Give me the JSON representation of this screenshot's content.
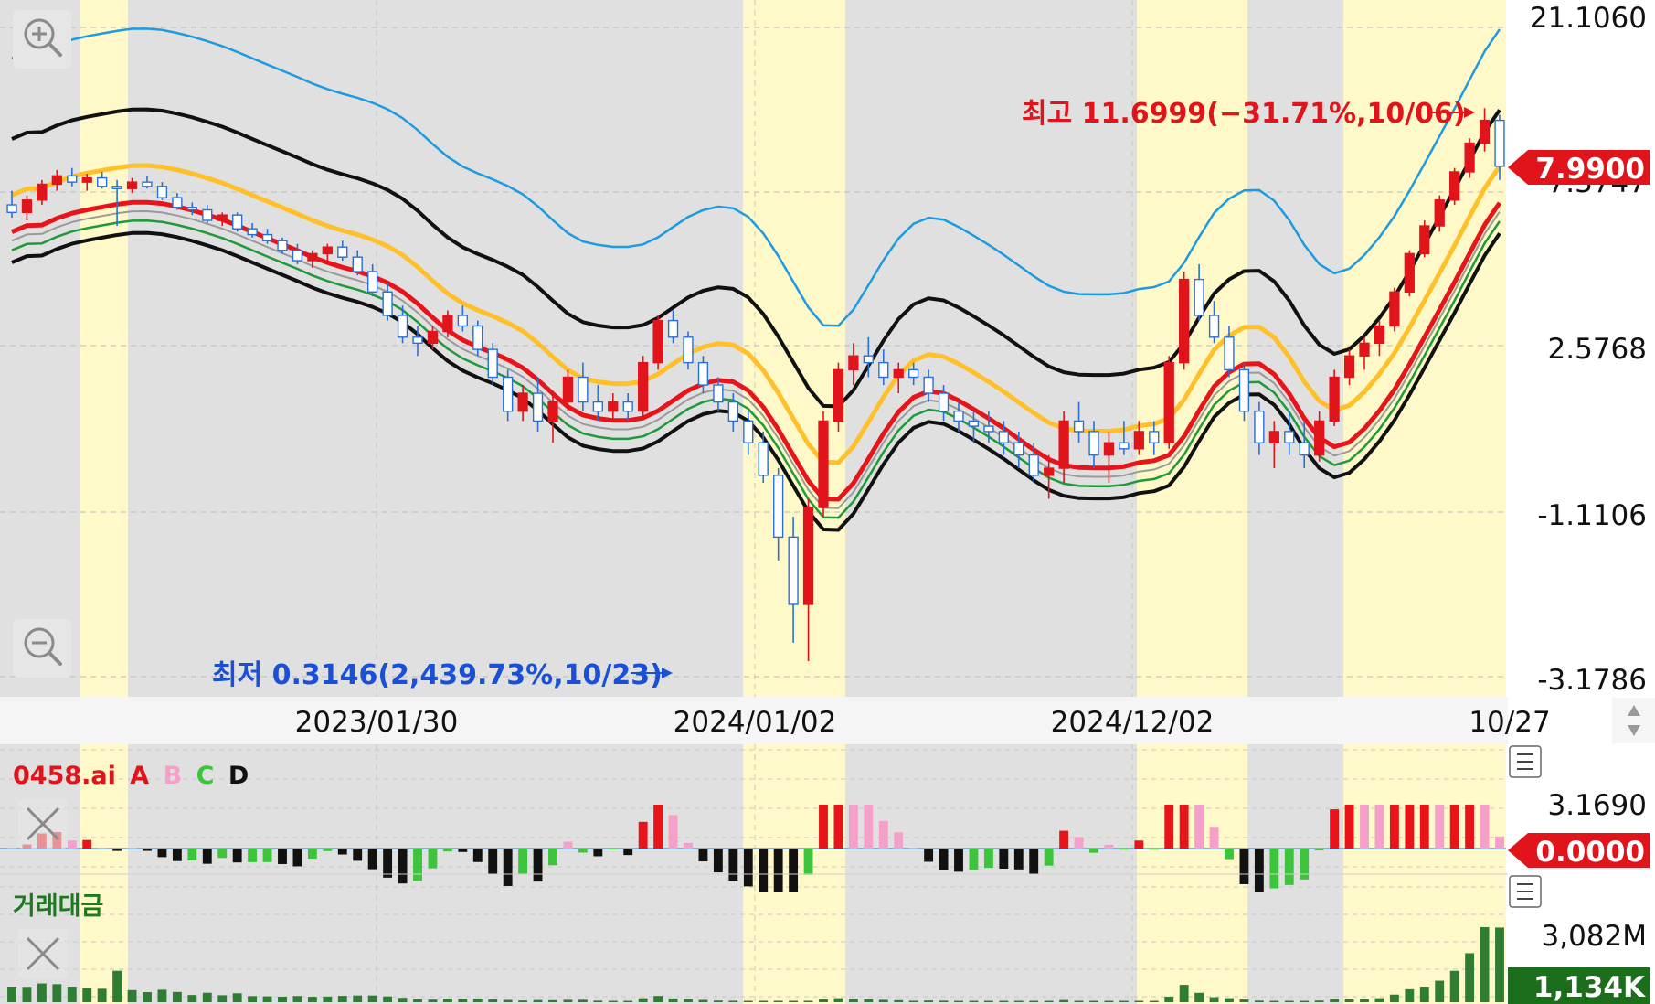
{
  "colors": {
    "up": "#e0141a",
    "down": "#2a6fd6",
    "shade_gray": "#e0e0e0",
    "shade_yellow": "#fff8c8",
    "ma_blue": "#1e9be0",
    "ma_black": "#111111",
    "ma_yellow": "#ffc02a",
    "ma_red": "#e8141a",
    "ma_gray": "#9a9a9a",
    "ma_green": "#1f9a3a",
    "vol_green": "#2e7d32",
    "osc_red": "#e8141a",
    "osc_pink": "#f4a0c8",
    "osc_green": "#3cc43c",
    "osc_black": "#111111"
  },
  "price_axis": {
    "ticks": [
      "21.1060",
      "2.5768",
      "-1.1106",
      "-3.1786"
    ],
    "hidden_tick": "7.3747",
    "current_badge": "7.9900"
  },
  "date_axis": {
    "labels": [
      "2023/01/30",
      "2024/01/02",
      "2024/12/02",
      "10/27"
    ]
  },
  "annotations": {
    "high": "최고 11.6999(−31.71%,10/06)",
    "low": "최저 0.3146(2,439.73%,10/23)"
  },
  "osc_pane": {
    "title_symbol": "0458.ai",
    "legend": [
      "A",
      "B",
      "C",
      "D"
    ],
    "max_label": "3.1690",
    "zero_badge": "0.0000"
  },
  "vol_pane": {
    "title": "거래대금",
    "max_label": "3,082M",
    "current_badge": "1,134K"
  },
  "icons": [
    "zoom-in-icon",
    "zoom-out-icon",
    "scroll-arrows-icon",
    "menu-icon",
    "close-icon"
  ],
  "chart_data": {
    "type": "candlestick",
    "y_scale": "log",
    "candles_ohlc_open_high_low_close": [
      [
        6.2,
        6.8,
        5.7,
        5.9
      ],
      [
        5.9,
        6.6,
        5.6,
        6.4
      ],
      [
        6.4,
        7.3,
        6.2,
        7.1
      ],
      [
        7.1,
        7.8,
        6.8,
        7.5
      ],
      [
        7.5,
        7.9,
        7.0,
        7.2
      ],
      [
        7.2,
        7.6,
        6.8,
        7.4
      ],
      [
        7.4,
        7.7,
        6.9,
        7.0
      ],
      [
        7.0,
        7.3,
        5.4,
        6.9
      ],
      [
        6.9,
        7.4,
        6.7,
        7.2
      ],
      [
        7.2,
        7.5,
        6.9,
        7.0
      ],
      [
        7.0,
        7.2,
        6.4,
        6.5
      ],
      [
        6.5,
        6.7,
        6.0,
        6.1
      ],
      [
        6.1,
        6.3,
        5.8,
        6.0
      ],
      [
        6.0,
        6.2,
        5.5,
        5.6
      ],
      [
        5.6,
        5.9,
        5.4,
        5.8
      ],
      [
        5.8,
        5.9,
        5.2,
        5.3
      ],
      [
        5.3,
        5.5,
        5.0,
        5.1
      ],
      [
        5.1,
        5.3,
        4.8,
        4.9
      ],
      [
        4.9,
        5.0,
        4.5,
        4.6
      ],
      [
        4.6,
        4.8,
        4.2,
        4.3
      ],
      [
        4.3,
        4.6,
        4.1,
        4.5
      ],
      [
        4.5,
        4.8,
        4.3,
        4.7
      ],
      [
        4.7,
        4.9,
        4.3,
        4.4
      ],
      [
        4.4,
        4.6,
        3.9,
        4.0
      ],
      [
        4.0,
        4.2,
        3.4,
        3.5
      ],
      [
        3.5,
        3.7,
        2.9,
        3.0
      ],
      [
        3.0,
        3.2,
        2.5,
        2.6
      ],
      [
        2.6,
        2.8,
        2.3,
        2.5
      ],
      [
        2.5,
        2.8,
        2.4,
        2.7
      ],
      [
        2.7,
        3.1,
        2.6,
        3.0
      ],
      [
        3.0,
        3.2,
        2.7,
        2.8
      ],
      [
        2.8,
        2.9,
        2.3,
        2.4
      ],
      [
        2.4,
        2.5,
        1.9,
        2.0
      ],
      [
        2.0,
        2.1,
        1.5,
        1.6
      ],
      [
        1.6,
        1.9,
        1.5,
        1.8
      ],
      [
        1.8,
        2.0,
        1.4,
        1.5
      ],
      [
        1.5,
        1.8,
        1.3,
        1.7
      ],
      [
        1.7,
        2.1,
        1.6,
        2.0
      ],
      [
        2.0,
        2.2,
        1.6,
        1.7
      ],
      [
        1.7,
        1.9,
        1.5,
        1.6
      ],
      [
        1.6,
        1.8,
        1.5,
        1.7
      ],
      [
        1.7,
        1.8,
        1.5,
        1.6
      ],
      [
        1.6,
        2.3,
        1.55,
        2.2
      ],
      [
        2.2,
        3.0,
        2.1,
        2.9
      ],
      [
        2.9,
        3.1,
        2.5,
        2.6
      ],
      [
        2.6,
        2.7,
        2.1,
        2.2
      ],
      [
        2.2,
        2.3,
        1.8,
        1.9
      ],
      [
        1.9,
        2.0,
        1.6,
        1.7
      ],
      [
        1.7,
        1.8,
        1.4,
        1.5
      ],
      [
        1.5,
        1.6,
        1.2,
        1.3
      ],
      [
        1.3,
        1.4,
        1.0,
        1.05
      ],
      [
        1.05,
        1.1,
        0.6,
        0.7
      ],
      [
        0.7,
        0.8,
        0.35,
        0.45
      ],
      [
        0.45,
        0.9,
        0.31,
        0.85
      ],
      [
        0.85,
        1.6,
        0.8,
        1.5
      ],
      [
        1.5,
        2.2,
        1.4,
        2.1
      ],
      [
        2.1,
        2.5,
        1.9,
        2.3
      ],
      [
        2.3,
        2.6,
        2.0,
        2.2
      ],
      [
        2.2,
        2.4,
        1.9,
        2.0
      ],
      [
        2.0,
        2.2,
        1.8,
        2.1
      ],
      [
        2.1,
        2.2,
        1.9,
        2.0
      ],
      [
        2.0,
        2.1,
        1.7,
        1.8
      ],
      [
        1.8,
        1.9,
        1.5,
        1.6
      ],
      [
        1.6,
        1.7,
        1.4,
        1.5
      ],
      [
        1.5,
        1.6,
        1.3,
        1.45
      ],
      [
        1.45,
        1.6,
        1.3,
        1.4
      ],
      [
        1.4,
        1.5,
        1.2,
        1.3
      ],
      [
        1.3,
        1.4,
        1.1,
        1.2
      ],
      [
        1.2,
        1.3,
        1.0,
        1.05
      ],
      [
        1.05,
        1.2,
        0.9,
        1.1
      ],
      [
        1.1,
        1.6,
        1.0,
        1.5
      ],
      [
        1.5,
        1.7,
        1.3,
        1.4
      ],
      [
        1.4,
        1.5,
        1.1,
        1.2
      ],
      [
        1.2,
        1.4,
        1.0,
        1.3
      ],
      [
        1.3,
        1.5,
        1.2,
        1.25
      ],
      [
        1.25,
        1.5,
        1.2,
        1.4
      ],
      [
        1.4,
        1.5,
        1.2,
        1.3
      ],
      [
        1.3,
        2.3,
        1.25,
        2.2
      ],
      [
        2.2,
        4.0,
        2.1,
        3.8
      ],
      [
        3.8,
        4.2,
        2.9,
        3.0
      ],
      [
        3.0,
        3.3,
        2.5,
        2.6
      ],
      [
        2.6,
        2.8,
        2.0,
        2.1
      ],
      [
        2.1,
        2.2,
        1.5,
        1.6
      ],
      [
        1.6,
        1.7,
        1.2,
        1.3
      ],
      [
        1.3,
        1.5,
        1.1,
        1.4
      ],
      [
        1.4,
        1.6,
        1.2,
        1.3
      ],
      [
        1.3,
        1.5,
        1.1,
        1.2
      ],
      [
        1.2,
        1.6,
        1.15,
        1.5
      ],
      [
        1.5,
        2.1,
        1.45,
        2.0
      ],
      [
        2.0,
        2.4,
        1.9,
        2.3
      ],
      [
        2.3,
        2.6,
        2.1,
        2.5
      ],
      [
        2.5,
        2.9,
        2.3,
        2.8
      ],
      [
        2.8,
        3.6,
        2.7,
        3.5
      ],
      [
        3.5,
        4.6,
        3.4,
        4.5
      ],
      [
        4.5,
        5.6,
        4.4,
        5.4
      ],
      [
        5.4,
        6.6,
        5.2,
        6.4
      ],
      [
        6.4,
        7.9,
        6.2,
        7.7
      ],
      [
        7.7,
        9.6,
        7.4,
        9.3
      ],
      [
        9.3,
        11.7,
        8.8,
        10.8
      ],
      [
        10.8,
        11.2,
        7.3,
        7.99
      ]
    ],
    "overlay_lines": [
      "blue upper band",
      "black upper band",
      "yellow moving average",
      "red moving average",
      "gray moving average",
      "green moving average",
      "black lower band"
    ],
    "volume_max": "3,082M",
    "volume_current": "1,134K"
  }
}
